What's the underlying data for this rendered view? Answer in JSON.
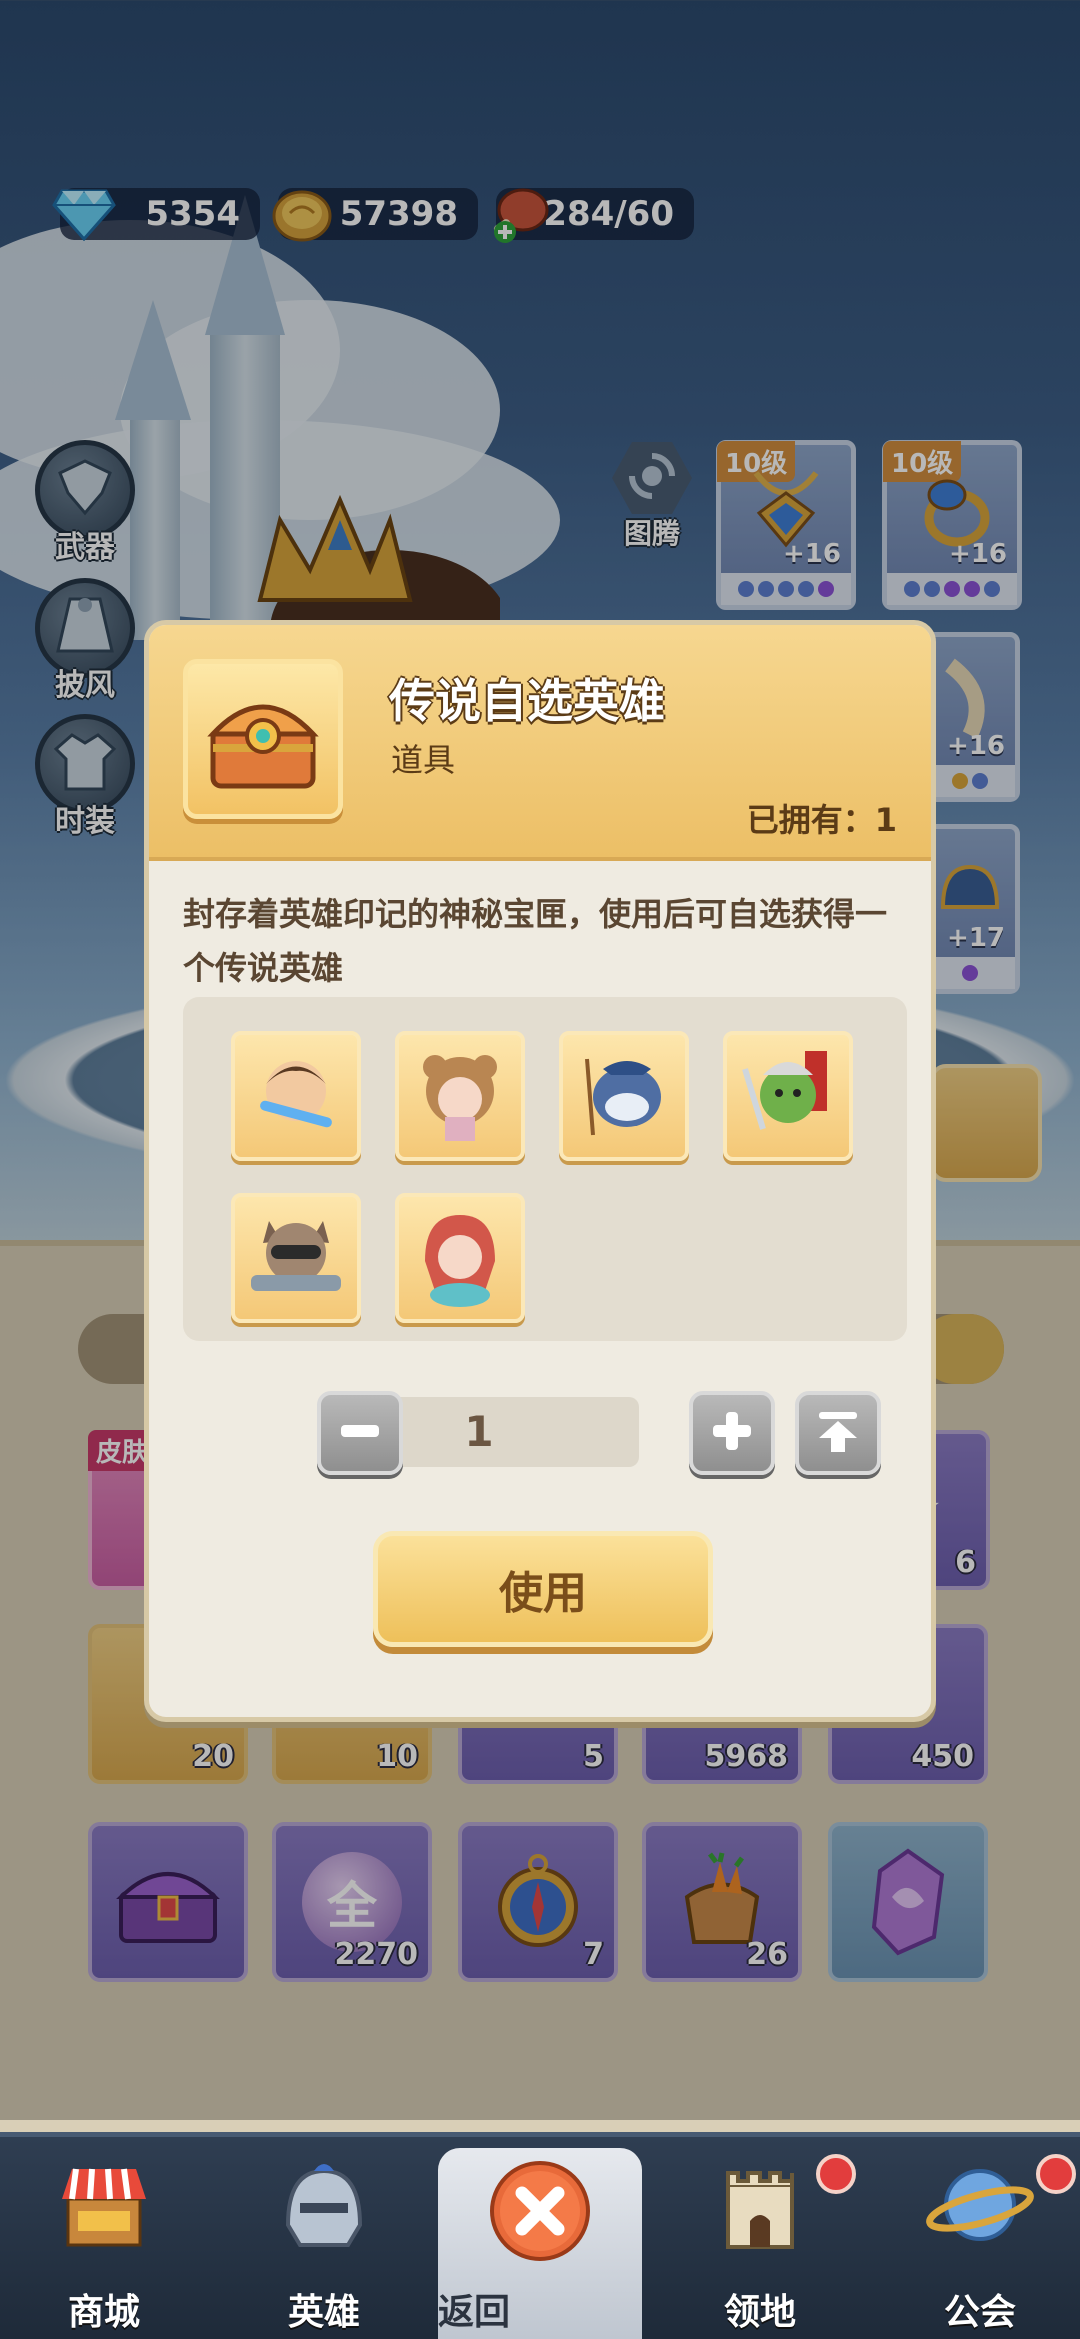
{
  "resources": [
    {
      "name": "diamond",
      "icon": "diamond-icon",
      "value": "5354"
    },
    {
      "name": "gold",
      "icon": "gold-coin-icon",
      "value": "57398"
    },
    {
      "name": "stamina",
      "icon": "meat-icon",
      "value": "284/60"
    }
  ],
  "side_menu": [
    {
      "label": "武器",
      "icon": "weapon-icon"
    },
    {
      "label": "披风",
      "icon": "cape-icon"
    },
    {
      "label": "时装",
      "icon": "costume-icon"
    }
  ],
  "totem": {
    "label": "图腾",
    "icon": "totem-icon"
  },
  "equipment": [
    {
      "level": "10级",
      "plus": "+16",
      "icon": "amulet-icon"
    },
    {
      "level": "10级",
      "plus": "+16",
      "icon": "ring-icon"
    },
    {
      "level": "",
      "plus": "+16",
      "icon": "horn-icon"
    },
    {
      "level": "",
      "plus": "+17",
      "icon": "helmet-icon"
    }
  ],
  "grid_items": [
    {
      "count": "6"
    },
    {
      "count": "20"
    },
    {
      "count": "10"
    },
    {
      "count": "5"
    },
    {
      "count": "5968"
    },
    {
      "count": "450"
    },
    {
      "count": ""
    },
    {
      "count": "2270",
      "symbol": "全"
    },
    {
      "count": "7"
    },
    {
      "count": "26"
    },
    {
      "count": ""
    }
  ],
  "skin_tag": "皮肤",
  "modal": {
    "title": "传说自选英雄",
    "type": "道具",
    "owned": "已拥有：1",
    "description": "封存着英雄印记的神秘宝匣，使用后可自选获得一个传说英雄",
    "heroes": [
      {
        "icon": "hero-warrior-icon",
        "color": "#7a5538"
      },
      {
        "icon": "hero-bear-girl-icon",
        "color": "#b98652"
      },
      {
        "icon": "hero-shark-fisher-icon",
        "color": "#4f6ea3"
      },
      {
        "icon": "hero-orc-icon",
        "color": "#6fb04a"
      },
      {
        "icon": "hero-raccoon-gunner-icon",
        "color": "#7a6150"
      },
      {
        "icon": "hero-mermaid-icon",
        "color": "#d2574a"
      }
    ],
    "quantity": "1",
    "use_label": "使用"
  },
  "nav": [
    {
      "label": "商城",
      "icon": "shop-icon",
      "badge": false
    },
    {
      "label": "英雄",
      "icon": "hero-helmet-icon",
      "badge": false
    },
    {
      "label": "返回",
      "icon": "close-icon",
      "badge": false
    },
    {
      "label": "领地",
      "icon": "castle-icon",
      "badge": true
    },
    {
      "label": "公会",
      "icon": "planet-icon",
      "badge": true
    }
  ],
  "colors": {
    "accent": "#eec05a",
    "modal_bg": "#efebe1",
    "nav_bg": "#1e2a39",
    "badge": "#e23d3d"
  }
}
